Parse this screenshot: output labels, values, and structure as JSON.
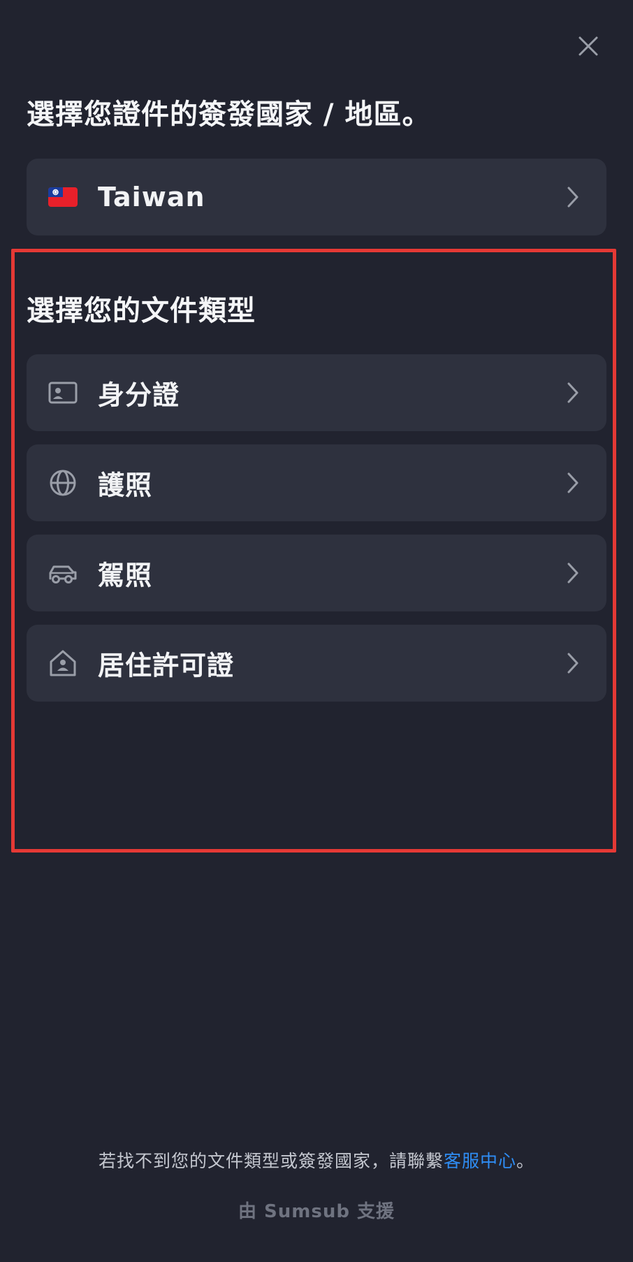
{
  "header": {
    "close_icon": "close-icon"
  },
  "country_section": {
    "heading": "選擇您證件的簽發國家 / 地區。",
    "selected_country": "Taiwan",
    "flag_icon": "taiwan-flag-icon"
  },
  "document_section": {
    "heading": "選擇您的文件類型",
    "options": [
      {
        "label": "身分證",
        "icon": "id-card-icon"
      },
      {
        "label": "護照",
        "icon": "globe-icon"
      },
      {
        "label": "駕照",
        "icon": "car-icon"
      },
      {
        "label": "居住許可證",
        "icon": "house-icon"
      }
    ]
  },
  "footer": {
    "help_prefix": "若找不到您的文件類型或簽發國家，請聯繫",
    "help_link": "客服中心",
    "help_suffix": "。",
    "powered_by": "由 Sumsub 支援"
  },
  "colors": {
    "background": "#21232f",
    "row_background": "#2e313e",
    "link": "#2f8df4",
    "highlight_border": "#e53935"
  }
}
